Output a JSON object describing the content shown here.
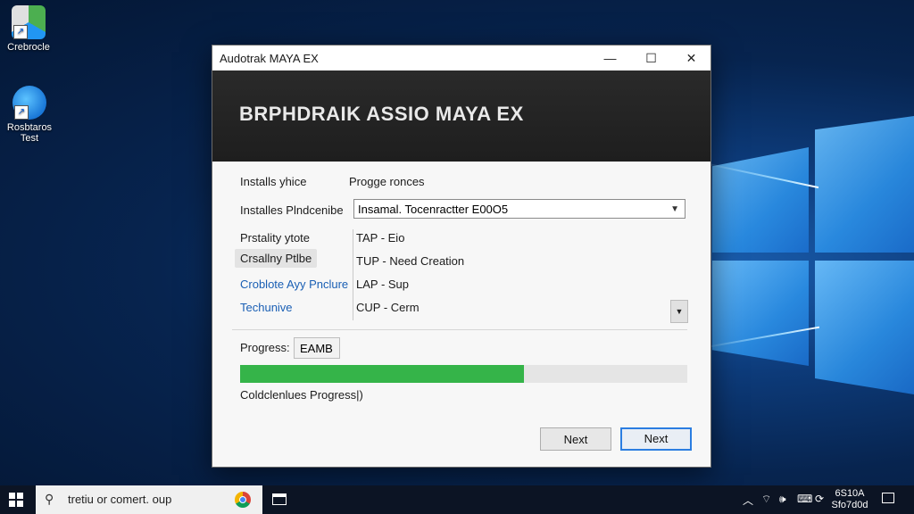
{
  "desktop": {
    "icons": [
      {
        "label": "Crebrocle"
      },
      {
        "label": "Rosbtaros Test"
      }
    ]
  },
  "window": {
    "title": "Audotrak MAYA EX",
    "controls": {
      "minimize": "—",
      "maximize": "☐",
      "close": "✕"
    },
    "banner_text": "BRPHDRAIK ASSIO MAYA EX",
    "install_choice_label": "Installs yhice",
    "install_choice_value": "Progge ronces",
    "installs_label": "Installes Plndcenibe",
    "installs_value": "Insamal. Tocenractter E00O5",
    "options": [
      {
        "label": "Prstality ytote",
        "value": "TAP - Eio",
        "style": "plain"
      },
      {
        "label": "Crsallny Ptlbe",
        "value": "TUP - Need Creation",
        "style": "highlight"
      },
      {
        "label": "Croblote Ayy Pnclure",
        "value": "LAP - Sup",
        "style": "link"
      },
      {
        "label": "Techunive",
        "value": "CUP - Cerm",
        "style": "link"
      }
    ],
    "progress_label": "Progress:",
    "progress_value": "EAMB",
    "progress_fraction": 0.634,
    "status_text": "Coldclenlues Progress|)",
    "buttons": {
      "back": "Next",
      "next": "Next"
    }
  },
  "taskbar": {
    "search_placeholder": "tretiu or comert. oup",
    "clock_time": "6S10A",
    "clock_date": "Sfo7d0d"
  },
  "colors": {
    "progress_fill": "#35b449",
    "link": "#1a5fb4",
    "primary_border": "#2b7de1"
  }
}
